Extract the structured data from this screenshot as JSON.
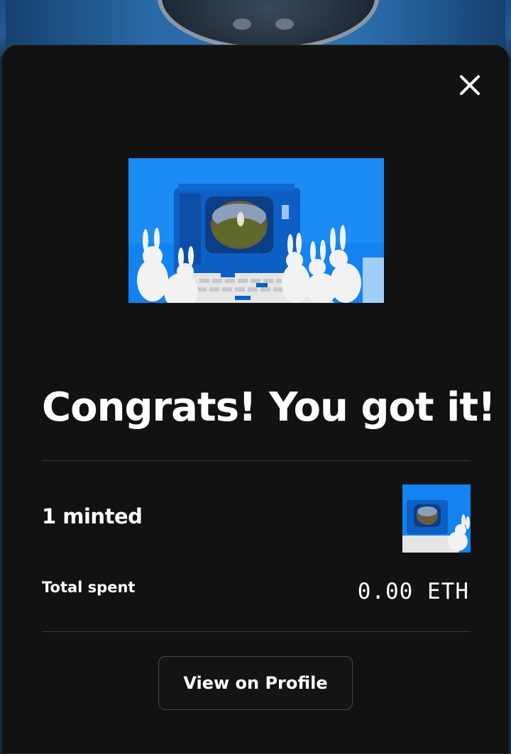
{
  "modal": {
    "title": "Congrats! You got it!",
    "minted_label": "1 minted",
    "total_spent_label": "Total spent",
    "total_spent_value": "0.00 ETH",
    "view_profile_label": "View on Profile"
  },
  "icons": {
    "close": "close-icon",
    "artwork": "nft-artwork-image",
    "thumbnail": "nft-thumbnail-image"
  },
  "colors": {
    "modal_bg": "#121212",
    "artwork_bg": "#1283f0",
    "text": "#ffffff",
    "divider": "#3a3a3a"
  }
}
